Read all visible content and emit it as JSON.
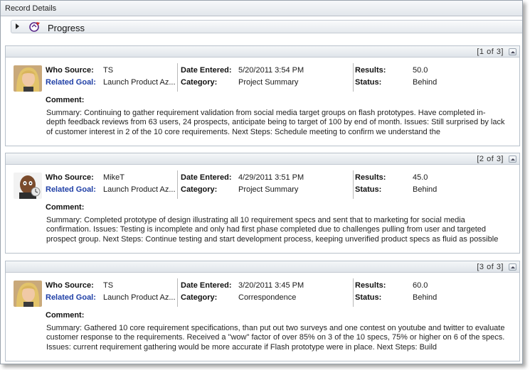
{
  "window": {
    "title": "Record Details"
  },
  "section": {
    "title": "Progress"
  },
  "labels": {
    "who_source": "Who Source:",
    "related_goal": "Related Goal:",
    "date_entered": "Date Entered:",
    "category": "Category:",
    "results": "Results:",
    "status": "Status:",
    "comment": "Comment:"
  },
  "records": [
    {
      "counter": "[1 of 3]",
      "who_source": "TS",
      "related_goal": "Launch Product Az...",
      "date_entered": "5/20/2011 3:54 PM",
      "category": "Project Summary",
      "results": "50.0",
      "status": "Behind",
      "comment": "Summary:  Continuing to gather requirement validation from social media target groups on flash prototypes.  Have completed in-depth feedback reviews from 63 users, 24 prospects, anticipate being to target of 100 by end of month.  Issues:  Still surprised by lack of customer interest in 2 of the 10 core requirements.    Next Steps:  Schedule meeting to confirm we understand the"
    },
    {
      "counter": "[2 of 3]",
      "who_source": "MikeT",
      "related_goal": "Launch Product Az...",
      "date_entered": "4/29/2011 3:51 PM",
      "category": "Project Summary",
      "results": "45.0",
      "status": "Behind",
      "comment": "Summary:  Completed prototype of design illustrating all 10 requirement specs and sent that to marketing for social media confirmation.  Issues:  Testing is incomplete and only had first phase completed due to challenges pulling from user and targeted prospect group.  Next Steps:  Continue testing and start development process, keeping unverified product specs as fluid as possible"
    },
    {
      "counter": "[3 of 3]",
      "who_source": "TS",
      "related_goal": "Launch Product Az...",
      "date_entered": "3/20/2011 3:45 PM",
      "category": "Correspondence",
      "results": "60.0",
      "status": "Behind",
      "comment": "Summary:  Gathered 10 core requirement specifications, than put out two surveys and one contest on youtube and twitter to evaluate customer response to the requirements.    Received a \"wow\" factor of over 85% on 3 of the 10 specs, 75% or higher on 6 of the specs.  Issues:  current requirement gathering would be more accurate if Flash prototype were in place.  Next Steps: Build"
    }
  ],
  "icons": [
    "expand-arrow-icon",
    "progress-icon",
    "collapse-icon",
    "avatar-woman",
    "avatar-man"
  ],
  "colors": {
    "link_label": "#1f3fa6",
    "header_bg": "#e2e6eb",
    "border": "#b7c0ca"
  }
}
